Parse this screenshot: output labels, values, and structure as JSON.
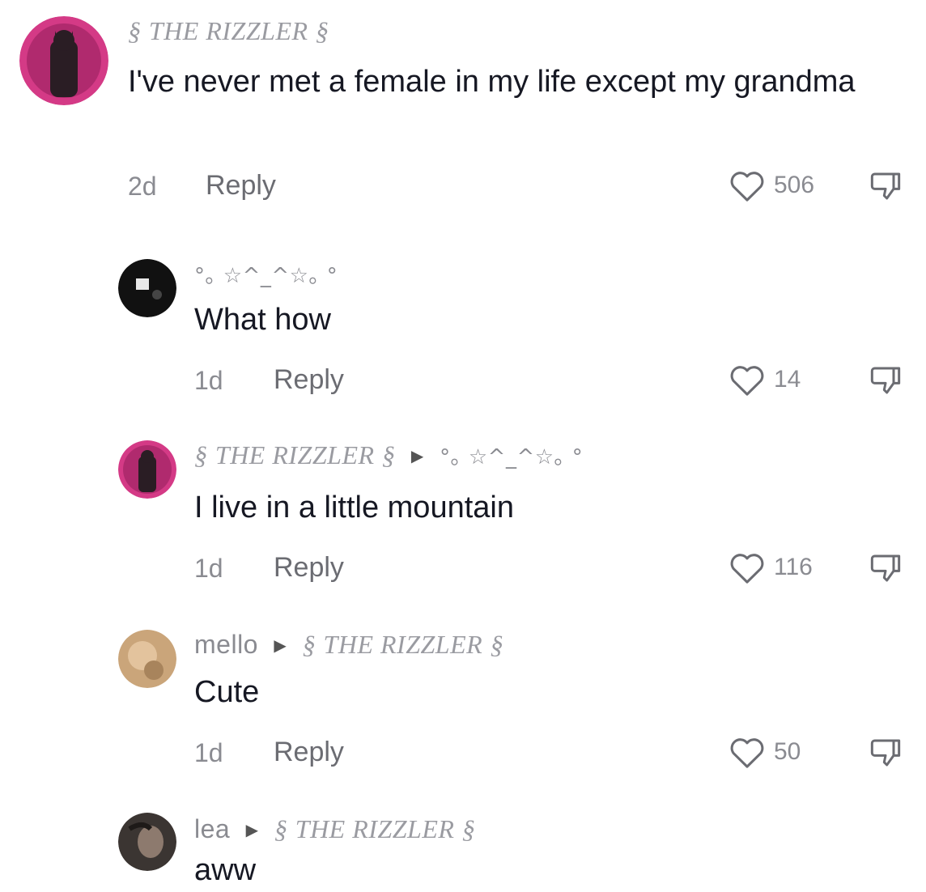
{
  "comments": [
    {
      "id": "c1",
      "username_decor_left": "§",
      "username_main": "THE RIZZLER",
      "username_decor_right": "§",
      "text": "I've never met a female in my life except my grandma",
      "age": "2d",
      "reply_label": "Reply",
      "likes": "506"
    },
    {
      "id": "c2",
      "username_symbols": "°｡ ☆^_^☆｡ °",
      "text": "What how",
      "age": "1d",
      "reply_label": "Reply",
      "likes": "14"
    },
    {
      "id": "c3",
      "username_decor_left": "§",
      "username_main": "THE RIZZLER",
      "username_decor_right": "§",
      "reply_to_symbols": "°｡ ☆^_^☆｡ °",
      "text": "I live in a little mountain",
      "age": "1d",
      "reply_label": "Reply",
      "likes": "116"
    },
    {
      "id": "c4",
      "username_plain": "mello",
      "reply_to_decor_left": "§",
      "reply_to_main": "THE RIZZLER",
      "reply_to_decor_right": "§",
      "text": "Cute",
      "age": "1d",
      "reply_label": "Reply",
      "likes": "50"
    },
    {
      "id": "c5",
      "username_plain": "lea",
      "reply_to_decor_left": "§",
      "reply_to_main": "THE RIZZLER",
      "reply_to_decor_right": "§",
      "text": "aww"
    }
  ],
  "colors": {
    "text": "#161823",
    "muted": "#8a8b91",
    "avatar_pink": "#d43a86",
    "avatar_black": "#111111",
    "avatar_beige": "#caa57a",
    "avatar_dark": "#3b3532"
  },
  "icons": [
    "heart-outline-icon",
    "dislike-icon",
    "reply-arrow-icon"
  ]
}
